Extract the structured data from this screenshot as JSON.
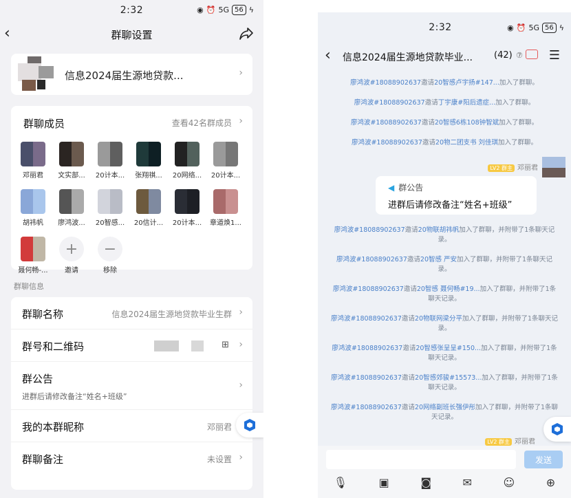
{
  "left": {
    "status": {
      "time": "2:32",
      "network": "5G",
      "battery": "56"
    },
    "nav": {
      "title": "群聊设置"
    },
    "group": {
      "name": "信息2024届生源地贷款..."
    },
    "members": {
      "title": "群聊成员",
      "view_all": "查看42名群成员",
      "list": [
        {
          "name": "邓丽君",
          "c1": "#4a4f6a",
          "c2": "#7a6b8a"
        },
        {
          "name": "文实部...",
          "c1": "#2b2522",
          "c2": "#6b5a4e"
        },
        {
          "name": "20计本...",
          "c1": "#9a9a9a",
          "c2": "#5f5f5f"
        },
        {
          "name": "张翔祺...",
          "c1": "#1f3a3a",
          "c2": "#0e1f24"
        },
        {
          "name": "20网络...",
          "c1": "#222",
          "c2": "#52615c"
        },
        {
          "name": "20计本...",
          "c1": "#9a9a9a",
          "c2": "#777"
        },
        {
          "name": "胡祎帆",
          "c1": "#8aa7d8",
          "c2": "#a9c6ec"
        },
        {
          "name": "廖鸿波...",
          "c1": "#555",
          "c2": "#aaa"
        },
        {
          "name": "20智感...",
          "c1": "#d2d4dc",
          "c2": "#b9bcc6"
        },
        {
          "name": "20信计...",
          "c1": "#6d5a3e",
          "c2": "#7f8aa0"
        },
        {
          "name": "20计本...",
          "c1": "#2a2d35",
          "c2": "#1d1f25"
        },
        {
          "name": "章道焕1...",
          "c1": "#a96a6a",
          "c2": "#c99090"
        },
        {
          "name": "聂何畅-...",
          "c1": "#d23b3b",
          "c2": "#c0b7a6"
        }
      ],
      "invite": "邀请",
      "remove": "移除"
    },
    "info_label": "群聊信息",
    "info": {
      "name_k": "群聊名称",
      "name_v": "信息2024届生源地贷款毕业生群",
      "qr_k": "群号和二维码",
      "ann_k": "群公告",
      "ann_sub": "进群后请修改备注“姓名+班级”",
      "nick_k": "我的本群昵称",
      "nick_v": "邓丽君",
      "remark_k": "群聊备注",
      "remark_v": "未设置"
    }
  },
  "right": {
    "status": {
      "time": "2:32",
      "network": "5G",
      "battery": "56"
    },
    "nav": {
      "title": "信息2024届生源地贷款毕业...",
      "count": "(42)"
    },
    "sys_top": [
      {
        "who": "廖鸿波#18088902637",
        "mid": "邀请",
        "target": "20智感卢宇扬#147...",
        "tail": "加入了群聊。"
      },
      {
        "who": "廖鸿波#18088902637",
        "mid": "邀请",
        "target": "丁宇康#阳后遗症...",
        "tail": "加入了群聊。"
      },
      {
        "who": "廖鸿波#18088902637",
        "mid": "邀请",
        "target": "20智感6栋108钟智斌",
        "tail": "加入了群聊。"
      },
      {
        "who": "廖鸿波#18088902637",
        "mid": "邀请",
        "target": "20物二团支书 刘佳琪",
        "tail": "加入了群聊。"
      }
    ],
    "sender": {
      "role": "LV2 群主",
      "name": "邓丽君"
    },
    "notice": {
      "label": "群公告",
      "text": "进群后请修改备注“姓名+班级”"
    },
    "sys_bottom": [
      {
        "who": "廖鸿波#18088902637",
        "mid": "邀请",
        "target": "20物联胡祎帆",
        "tail": "加入了群聊，并附带了1条聊天记录。"
      },
      {
        "who": "廖鸿波#18088902637",
        "mid": "邀请",
        "target": "20智感 严安",
        "tail": "加入了群聊，并附带了1条聊天记录。"
      },
      {
        "who": "廖鸿波#18088902637",
        "mid": "邀请",
        "target": "20智感 聂何畅#19...",
        "tail": "加入了群聊，并附带了1条聊天记录。"
      },
      {
        "who": "廖鸿波#18088902637",
        "mid": "邀请",
        "target": "20物联网梁分平",
        "tail": "加入了群聊，并附带了1条聊天记录。"
      },
      {
        "who": "廖鸿波#18088902637",
        "mid": "邀请",
        "target": "20智感张呈呈#150...",
        "tail": "加入了群聊，并附带了1条聊天记录。"
      },
      {
        "who": "廖鸿波#18088902637",
        "mid": "邀请",
        "target": "20智感郊骏#15573...",
        "tail": "加入了群聊，并附带了1条聊天记录。"
      },
      {
        "who": "廖鸿波#18088902637",
        "mid": "邀请",
        "target": "20网络副班长强伊彤",
        "tail": "加入了群聊，并附带了1条聊天记录。"
      }
    ],
    "sender2": {
      "role": "LV2 群主",
      "name": "邓丽君"
    },
    "input": {
      "send": "发送"
    }
  }
}
